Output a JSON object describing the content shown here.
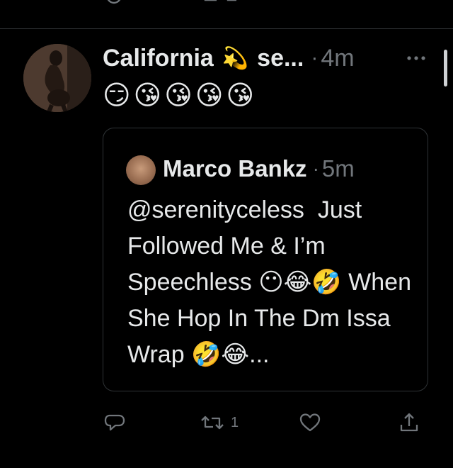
{
  "tweet": {
    "display_name": "California",
    "name_emoji": "💫",
    "handle_truncated": "se...",
    "separator": "·",
    "timestamp": "4m",
    "body_emoji": "😏😘😘😘😘"
  },
  "quoted_tweet": {
    "display_name": "Marco Bankz",
    "separator": "·",
    "timestamp": "5m",
    "text": "@serenityceless  Just Followed Me & I’m Speechless 😶😂🤣 When She Hop In The Dm Issa Wrap 🤣😂..."
  },
  "actions": {
    "reply_icon": "reply-icon",
    "retweet_icon": "retweet-icon",
    "retweet_count": "1",
    "like_icon": "heart-icon",
    "share_icon": "share-icon"
  },
  "colors": {
    "background": "#000000",
    "text_primary": "#e7e9ea",
    "text_secondary": "#71767b",
    "border": "#2f3336",
    "like_pink": "#f91880"
  }
}
